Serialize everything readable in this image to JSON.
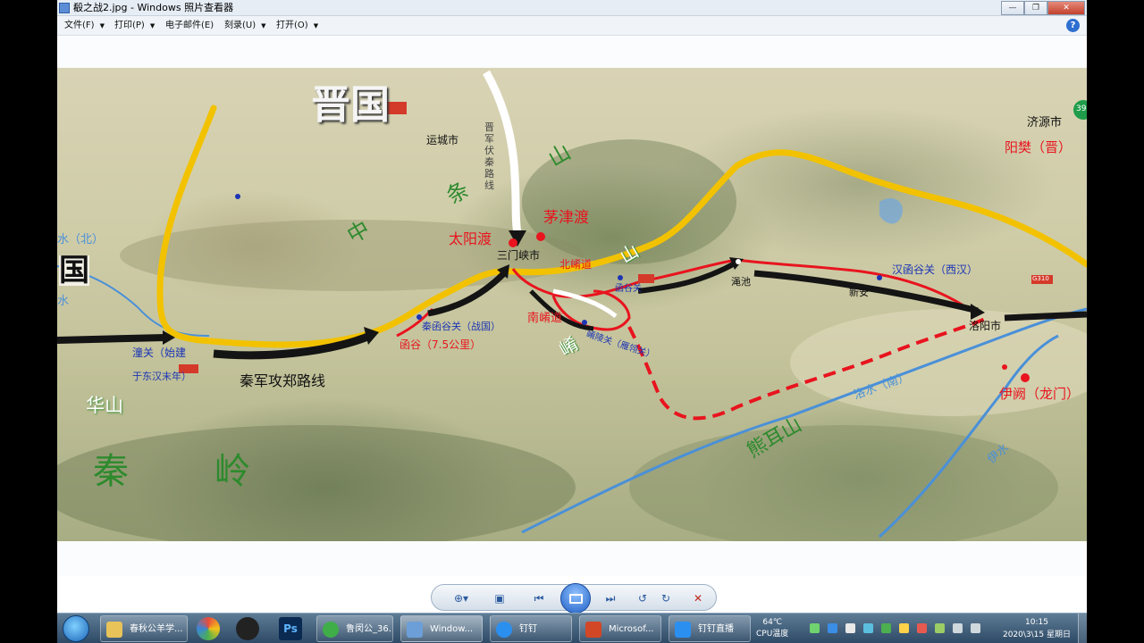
{
  "window": {
    "title": "殽之战2.jpg - Windows 照片查看器"
  },
  "menu": {
    "items": [
      {
        "label": "文件(F)",
        "caret": "▼"
      },
      {
        "label": "打印(P)",
        "caret": "▼"
      },
      {
        "label": "电子邮件(E)",
        "caret": ""
      },
      {
        "label": "刻录(U)",
        "caret": "▼"
      },
      {
        "label": "打开(O)",
        "caret": "▼"
      }
    ],
    "help": "?"
  },
  "map": {
    "labels": {
      "jin_state": "晋国",
      "guo_partial": "国",
      "yuncheng": "运城市",
      "jiyuan": "济源市",
      "yangfan": "阳樊（晋）",
      "shan_top": "山",
      "tiao": "条",
      "zhong": "中",
      "taiyang_du": "太阳渡",
      "maojin_du": "茅津渡",
      "sanmenxia": "三门峡市",
      "beixiao_dao": "北崤道",
      "shan_mid": "山",
      "hangu_guan_small": "函谷关",
      "mianchi": "渑池",
      "xinan": "新安",
      "hangu_guan_han": "汉函谷关（西汉）",
      "luoyang": "洛阳市",
      "river_bei": "水（北）",
      "qin_hangu_guan": "秦函谷关（战国）",
      "hangu": "函谷（7.5公里）",
      "nanxiao_dao": "南崤道",
      "xiao_small": "崤",
      "xiaoling_guan": "崤陵关（雁翎关）",
      "tong_guan": "潼关（始建",
      "tong_guan_2": "于东汉末年）",
      "qin_attack_route": "秦军攻郑路线",
      "luo_shui": "洛水（南）",
      "yique": "伊阙（龙门）",
      "huashan": "华山",
      "qin": "秦",
      "ling": "岭",
      "xiong_er_shan": "熊耳山",
      "yi_shui": "伊水",
      "jin_ambush_route": "晋军伏秦路线",
      "shui_left": "水",
      "badge": "39",
      "g310": "G310"
    },
    "colors": {
      "yellow_route": "#f2c200",
      "red_route": "#e8141e",
      "black_route": "#141414",
      "white_route": "#ffffff",
      "river": "#4a90d8",
      "place_black": "#111111",
      "place_red": "#e8141e",
      "place_blue": "#1b35b5",
      "mountain_green": "#2d8a2d"
    }
  },
  "viewer_toolbar": {
    "buttons": [
      "zoom-icon",
      "actual-size-icon",
      "previous-icon",
      "slideshow-icon",
      "next-icon",
      "rotate-ccw-icon",
      "rotate-cw-icon",
      "delete-icon"
    ],
    "zoom_glyph": "⊕▾",
    "actual_size_glyph": "▣",
    "prev_glyph": "⏮",
    "next_glyph": "⏭",
    "rotate_ccw_glyph": "↺",
    "rotate_cw_glyph": "↻",
    "delete_glyph": "✕"
  },
  "taskbar": {
    "apps": [
      {
        "label": "春秋公羊学..."
      },
      {
        "label": "鲁闵公_36..."
      },
      {
        "label": "Window..."
      },
      {
        "label": "钉钉"
      },
      {
        "label": "Microsof..."
      },
      {
        "label": "钉钉直播"
      }
    ],
    "cpu_temp": "64℃",
    "cpu_label": "CPU温度",
    "time": "10:15",
    "date": "2020\\3\\15 星期日"
  }
}
